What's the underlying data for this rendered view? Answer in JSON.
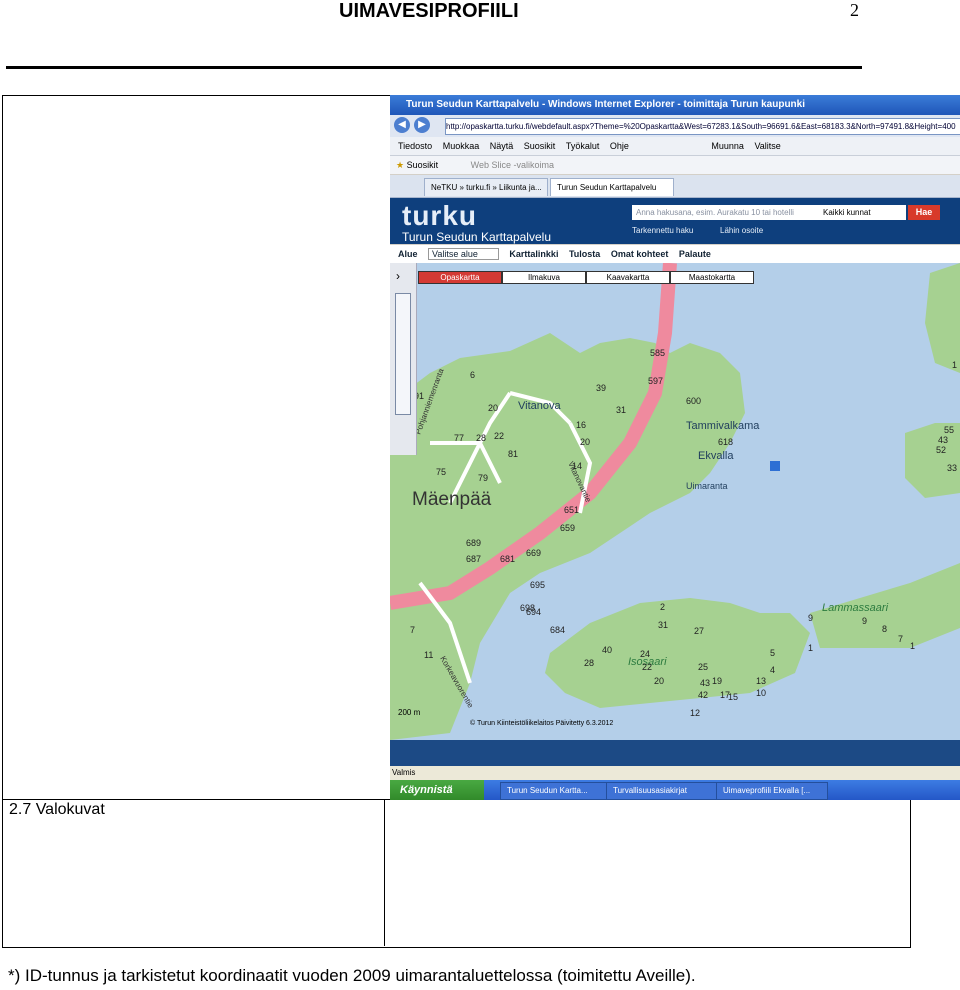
{
  "document": {
    "title": "UIMAVESIPROFIILI",
    "page_number": "2",
    "section_label": "2.7 Valokuvat",
    "footnote": "*) ID-tunnus ja tarkistetut koordinaatit vuoden 2009 uimarantaluettelossa (toimitettu Aveille)."
  },
  "browser": {
    "window_title": "Turun Seudun Karttapalvelu - Windows Internet Explorer - toimittaja Turun kaupunki",
    "address": "http://opaskartta.turku.fi/webdefault.aspx?Theme=%20Opaskartta&West=67283.1&South=96691.6&East=68183.3&North=97491.8&Height=400",
    "menu_items": [
      "Tiedosto",
      "Muokkaa",
      "Näytä",
      "Suosikit",
      "Työkalut",
      "Ohje"
    ],
    "toolbar_right": [
      "Muunna",
      "Valitse"
    ],
    "favorites_label": "Suosikit",
    "webslice_label": "Web Slice -valikoima",
    "tabs": [
      "NeTKU » turku.fi » Liikunta ja...",
      "Turun Seudun Karttapalvelu"
    ],
    "status": "Valmis"
  },
  "site": {
    "logo": "turku",
    "subtitle": "Turun Seudun Karttapalvelu",
    "search_placeholder": "Anna hakusana, esim. Aurakatu 10 tai hotelli",
    "search_select": "Kaikki kunnat",
    "search_button": "Hae",
    "link_advanced": "Tarkennettu haku",
    "link_nearby": "Lähin osoite",
    "toolbar": [
      "Alue",
      "Valitse alue",
      "Karttalinkki",
      "Tulosta",
      "Omat kohteet",
      "Palaute"
    ],
    "map_tabs": [
      "Opaskartta",
      "Ilmakuva",
      "Kaavakartta",
      "Maastokartta"
    ],
    "scale": "200 m",
    "copyright": "© Turun Kiinteistöliikelaitos Päivitetty 6.3.2012"
  },
  "map_labels": {
    "places": [
      "Mäenpää",
      "Vitanova",
      "Tammivalkama",
      "Ekvalla",
      "Uimaranta",
      "Isosaari",
      "Lammassaari"
    ],
    "roads": [
      "Pohjanniemenranta",
      "Vitanovantie",
      "Korkeavuorentie"
    ],
    "numbers": [
      "6",
      "20",
      "91",
      "77",
      "28",
      "22",
      "81",
      "75",
      "79",
      "39",
      "31",
      "16",
      "20",
      "14",
      "585",
      "597",
      "600",
      "618",
      "651",
      "659",
      "689",
      "687",
      "681",
      "669",
      "695",
      "698",
      "694",
      "684",
      "7",
      "11",
      "9",
      "1",
      "5",
      "4",
      "2",
      "31",
      "27",
      "40",
      "24",
      "28",
      "22",
      "20",
      "25",
      "43",
      "19",
      "17",
      "15",
      "13",
      "10",
      "42",
      "12",
      "9",
      "8",
      "7",
      "1",
      "55",
      "52",
      "43",
      "33",
      "45",
      "1",
      "24"
    ]
  },
  "taskbar": {
    "start": "Käynnistä",
    "items": [
      "Turun Seudun Kartta...",
      "Turvallisuusasiakirjat",
      "Uimaveprofiili Ekvalla [..."
    ]
  }
}
